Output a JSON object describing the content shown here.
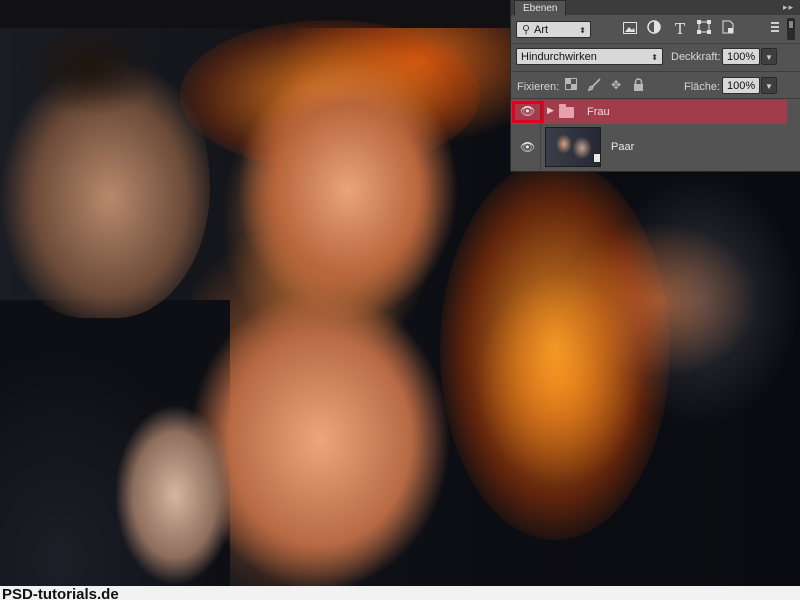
{
  "panel": {
    "tab_label": "Ebenen",
    "collapse_glyph": "▸▸",
    "filter": {
      "icon": "search-icon",
      "value": "Art"
    },
    "filter_icons": [
      "image-filter-icon",
      "adjustment-filter-icon",
      "type-filter-icon",
      "shape-filter-icon",
      "smart-object-filter-icon"
    ],
    "blend_mode": "Hindurchwirken",
    "opacity_label": "Deckkraft:",
    "opacity_value": "100%",
    "lock_label": "Fixieren:",
    "lock_icons": [
      "lock-transparent-icon",
      "lock-image-icon",
      "lock-position-icon",
      "lock-all-icon"
    ],
    "fill_label": "Fläche:",
    "fill_value": "100%",
    "layers": [
      {
        "name": "Frau",
        "type": "group",
        "selected": true,
        "visible": true
      },
      {
        "name": "Paar",
        "type": "smart-object",
        "selected": false,
        "visible": true
      }
    ]
  },
  "colors": {
    "panel_bg": "#535353",
    "selected_layer": "#a13c4d",
    "highlight_box": "#e3001b"
  },
  "bottom_text": "PSD-tutorials.de"
}
